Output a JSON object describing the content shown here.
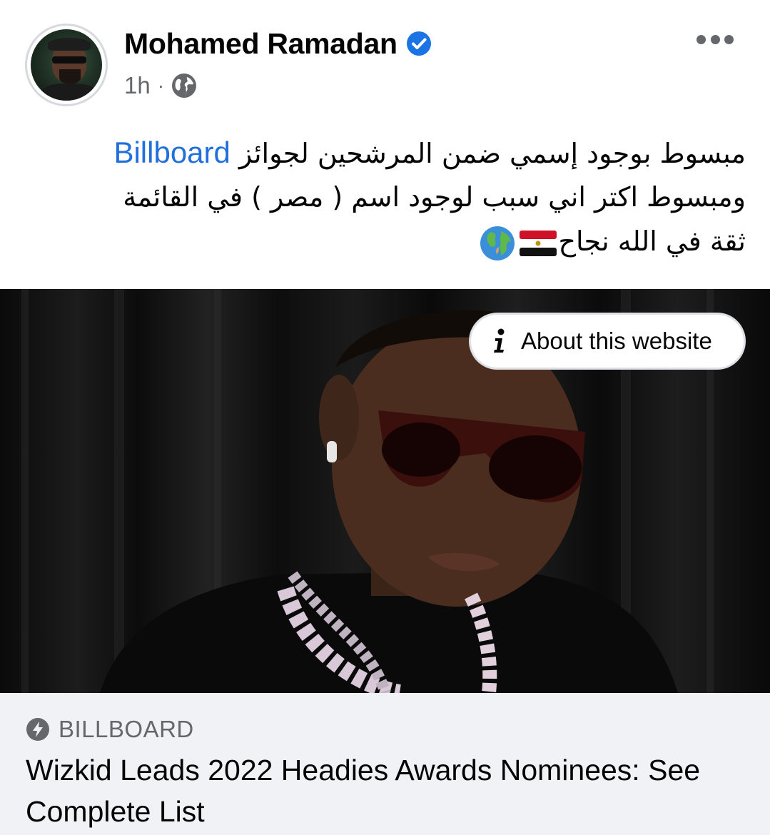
{
  "post": {
    "author": "Mohamed Ramadan",
    "verified": true,
    "time": "1h",
    "separator": "·",
    "audience_icon": "globe-icon",
    "more_icon": "more-dots-icon",
    "text_lines": [
      {
        "before": "مبسوط بوجود إسمي ضمن المرشحين لجوائز",
        "link": "Billboard"
      },
      {
        "text": "ومبسوط اكتر اني سبب لوجود اسم ( مصر ) في القائمة"
      },
      {
        "text": "ثقة في الله نجاح",
        "emoji": [
          "egypt-flag-icon",
          "earth-globe-icon"
        ]
      }
    ]
  },
  "link_preview": {
    "about_label": "About this website",
    "about_icon": "info-icon",
    "domain_icon": "bolt-icon",
    "domain": "BILLBOARD",
    "title": "Wizkid Leads 2022 Headies Awards Nominees: See Complete List"
  },
  "colors": {
    "link": "#216fdb",
    "verified": "#1b74e4",
    "secondary_text": "#65676b",
    "footer_bg": "#f0f2f5"
  }
}
